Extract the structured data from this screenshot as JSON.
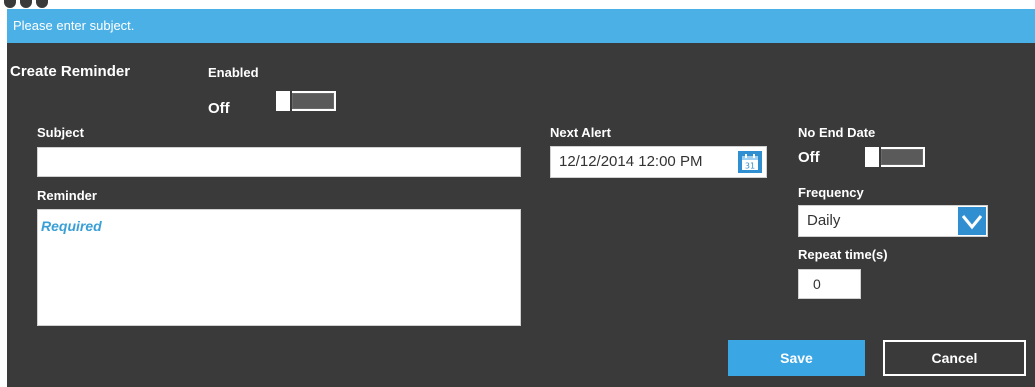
{
  "banner": {
    "message": "Please enter subject."
  },
  "form": {
    "title": "Create Reminder",
    "enabled": {
      "label": "Enabled",
      "state": "Off"
    },
    "subject": {
      "label": "Subject",
      "value": ""
    },
    "reminder": {
      "label": "Reminder",
      "placeholder": "Required"
    },
    "next_alert": {
      "label": "Next Alert",
      "value": "12/12/2014 12:00 PM",
      "calendar_day": "31"
    },
    "no_end_date": {
      "label": "No End Date",
      "state": "Off"
    },
    "frequency": {
      "label": "Frequency",
      "value": "Daily"
    },
    "repeat": {
      "label": "Repeat time(s)",
      "value": "0"
    }
  },
  "buttons": {
    "save": "Save",
    "cancel": "Cancel"
  },
  "colors": {
    "accent": "#4bb0e6",
    "panel": "#3a3a3a",
    "button_blue": "#3aa6e4"
  },
  "icons": {
    "calendar": "calendar-icon",
    "chevron": "chevron-down-icon"
  }
}
